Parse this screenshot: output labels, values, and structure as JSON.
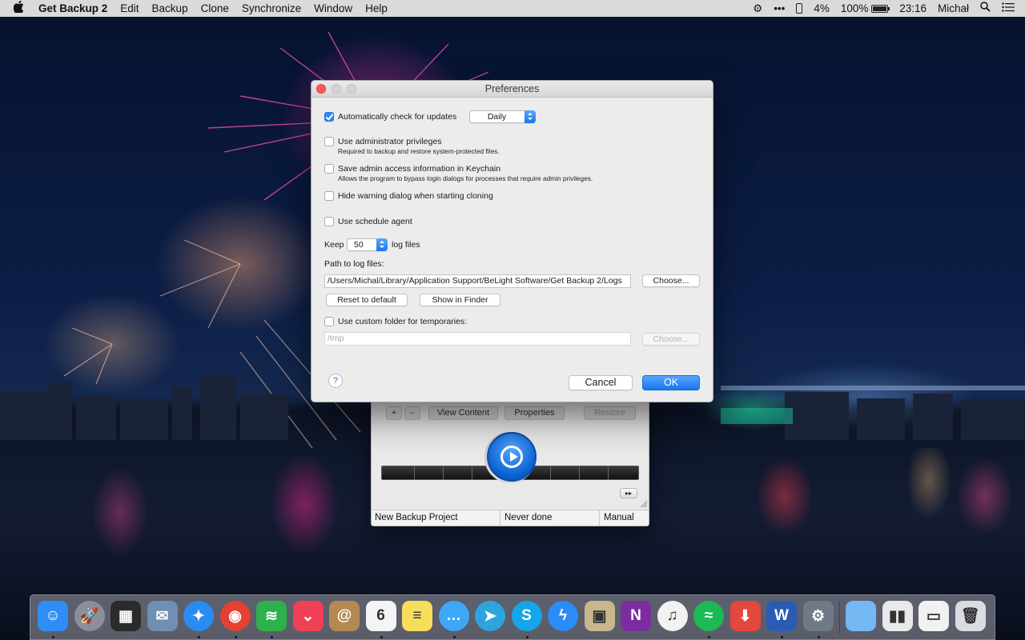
{
  "menubar": {
    "apple": "",
    "app_name": "Get Backup 2",
    "menus": [
      "Edit",
      "Backup",
      "Clone",
      "Synchronize",
      "Window",
      "Help"
    ],
    "status": {
      "dots": "•••",
      "percent_small": "4%",
      "battery_percent": "100%",
      "time": "23:16",
      "user": "Michał",
      "search_icon": "search-icon",
      "list_icon": "notification-center-icon"
    }
  },
  "prefs": {
    "title": "Preferences",
    "auto_update": {
      "label": "Automatically check for updates",
      "checked": true,
      "frequency": "Daily"
    },
    "admin": {
      "label": "Use administrator privileges",
      "sub": "Required to backup and restore system-protected files.",
      "checked": false
    },
    "keychain": {
      "label": "Save admin access information in Keychain",
      "sub": "Allows the program to bypass login dialogs for processes that require admin privileges.",
      "checked": false
    },
    "hide_warning": {
      "label": "Hide warning dialog when starting cloning",
      "checked": false
    },
    "schedule": {
      "label": "Use schedule agent",
      "checked": false
    },
    "keep": {
      "prefix": "Keep",
      "value": "50",
      "suffix": "log files"
    },
    "log_path": {
      "label": "Path to log files:",
      "value": "/Users/Michal/Library/Application Support/BeLight Software/Get Backup 2/Logs",
      "choose": "Choose...",
      "reset": "Reset to default",
      "show": "Show in Finder"
    },
    "custom_tmp": {
      "label": "Use custom folder for temporaries:",
      "checked": false,
      "placeholder": "/tmp",
      "choose": "Choose..."
    },
    "help": "?",
    "cancel": "Cancel",
    "ok": "OK"
  },
  "main_window": {
    "toolbar": {
      "add": "+",
      "remove": "-",
      "view_content": "View Content",
      "properties": "Properties",
      "restore": "Restore"
    },
    "ff": "▸▸",
    "list_row": {
      "name": "New Backup Project",
      "last": "Never done",
      "mode": "Manual"
    }
  },
  "dock": {
    "apps": [
      {
        "name": "Finder",
        "icon": "finder-icon",
        "color": "#2f8ef5",
        "glyph": "☺",
        "running": true
      },
      {
        "name": "Launchpad",
        "icon": "launchpad-icon",
        "color": "#8a8f99",
        "glyph": "🚀",
        "running": false
      },
      {
        "name": "Photo Slideshow",
        "icon": "slideshow-icon",
        "color": "#2b2b2b",
        "glyph": "▦",
        "running": false
      },
      {
        "name": "Mail Bird",
        "icon": "bird-icon",
        "color": "#6f8fb3",
        "glyph": "✉",
        "running": false
      },
      {
        "name": "Safari",
        "icon": "safari-icon",
        "color": "#2a8cf0",
        "glyph": "✦",
        "running": true
      },
      {
        "name": "Chrome",
        "icon": "chrome-icon",
        "color": "#e34133",
        "glyph": "◉",
        "running": true
      },
      {
        "name": "Feedly",
        "icon": "feedly-icon",
        "color": "#2bb24c",
        "glyph": "≋",
        "running": true
      },
      {
        "name": "Pocket",
        "icon": "pocket-icon",
        "color": "#ef4056",
        "glyph": "⌄",
        "running": false
      },
      {
        "name": "Contacts",
        "icon": "contacts-icon",
        "color": "#b58a52",
        "glyph": "@",
        "running": false
      },
      {
        "name": "Calendar",
        "icon": "calendar-icon",
        "color": "#f4f4f4",
        "glyph": "6",
        "running": true
      },
      {
        "name": "Notes",
        "icon": "notes-icon",
        "color": "#f6dd5a",
        "glyph": "≡",
        "running": false
      },
      {
        "name": "Messages",
        "icon": "messages-icon",
        "color": "#3ea8f7",
        "glyph": "…",
        "running": true
      },
      {
        "name": "Telegram",
        "icon": "telegram-icon",
        "color": "#2ea4df",
        "glyph": "➤",
        "running": false
      },
      {
        "name": "Skype",
        "icon": "skype-icon",
        "color": "#14a6e8",
        "glyph": "S",
        "running": true
      },
      {
        "name": "Messenger",
        "icon": "messenger-icon",
        "color": "#2c8cf6",
        "glyph": "ϟ",
        "running": false
      },
      {
        "name": "Preview",
        "icon": "preview-icon",
        "color": "#c8b68f",
        "glyph": "▣",
        "running": false
      },
      {
        "name": "OneNote",
        "icon": "onenote-icon",
        "color": "#7b2c9f",
        "glyph": "N",
        "running": false
      },
      {
        "name": "iTunes",
        "icon": "itunes-icon",
        "color": "#f2f2f2",
        "glyph": "♫",
        "running": false
      },
      {
        "name": "Spotify",
        "icon": "spotify-icon",
        "color": "#1db954",
        "glyph": "≈",
        "running": true
      },
      {
        "name": "Downloader",
        "icon": "download-icon",
        "color": "#e4473d",
        "glyph": "⬇",
        "running": false
      },
      {
        "name": "Word",
        "icon": "word-icon",
        "color": "#2b5cb3",
        "glyph": "W",
        "running": true
      },
      {
        "name": "Get Backup",
        "icon": "get-backup-icon",
        "color": "#6f7a86",
        "glyph": "⚙",
        "running": true
      },
      {
        "name": "Downloads folder",
        "icon": "folder-icon",
        "color": "#74b8f4",
        "glyph": "",
        "running": false
      },
      {
        "name": "Files stack",
        "icon": "stack-icon",
        "color": "#e9e9e9",
        "glyph": "▮▮",
        "running": false
      },
      {
        "name": "Document stack",
        "icon": "document-icon",
        "color": "#f1f1f1",
        "glyph": "▭",
        "running": false
      },
      {
        "name": "Trash",
        "icon": "trash-icon",
        "color": "#d9dde2",
        "glyph": "🗑",
        "running": false
      }
    ]
  }
}
